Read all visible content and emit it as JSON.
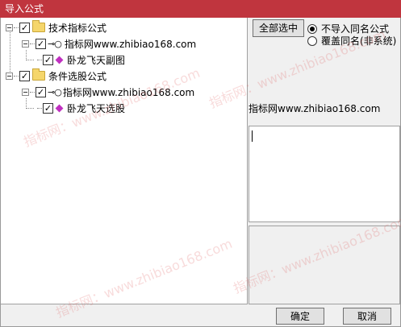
{
  "window": {
    "title": "导入公式"
  },
  "tree": {
    "groups": [
      {
        "label": "技术指标公式",
        "checked": true,
        "source": "指标网www.zhibiao168.com",
        "items": [
          "卧龙飞天副图"
        ]
      },
      {
        "label": "条件选股公式",
        "checked": true,
        "source": "指标网www.zhibiao168.com",
        "items": [
          "卧龙飞天选股"
        ]
      }
    ]
  },
  "right": {
    "select_all_label": "全部选中",
    "radio_options": [
      {
        "label": "不导入同名公式",
        "selected": true
      },
      {
        "label": "覆盖同名(非系统)",
        "selected": false
      }
    ],
    "source_url": "指标网www.zhibiao168.com"
  },
  "footer": {
    "ok_label": "确定",
    "cancel_label": "取消"
  },
  "watermark": {
    "text": "指标网：www.zhibiao168.com"
  },
  "colors": {
    "titlebar": "#c0353e",
    "item_icon": "#c030c0"
  }
}
